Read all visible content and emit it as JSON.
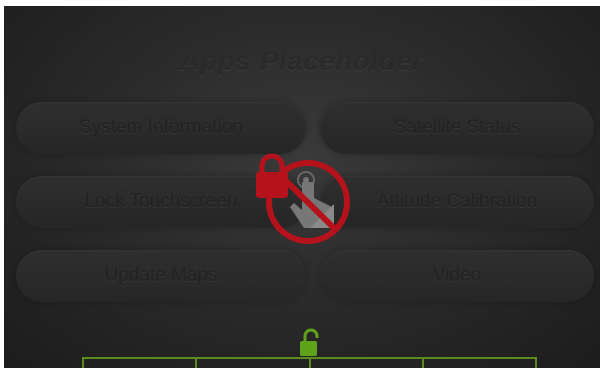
{
  "title": "Apps Placeholder",
  "buttons": {
    "system_information": "System Information",
    "satellite_status": "Satellite Status",
    "lock_touchscreen": "Lock Touchscreen",
    "attitude_calibration": "Attitude Calibration",
    "update_maps": "Update Maps",
    "video": "Video"
  },
  "overlay": {
    "state": "touchscreen-locked",
    "icons": [
      "lock-icon",
      "no-touch-icon"
    ]
  },
  "colors": {
    "lock_red": "#b5121b",
    "unlock_green": "#5fa31a",
    "tab_border_green": "#5b8a1f",
    "button_text": "#222222"
  },
  "tabs": [
    "",
    "",
    "",
    ""
  ]
}
